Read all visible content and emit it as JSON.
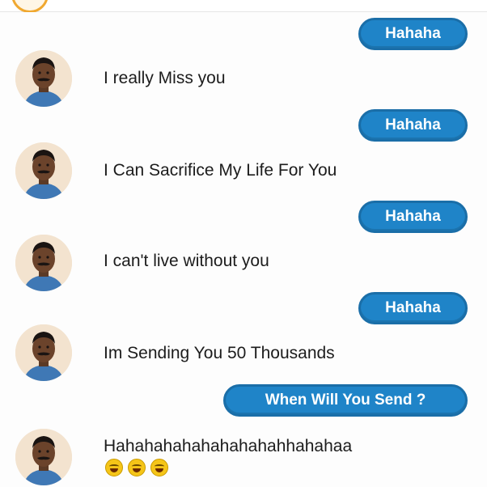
{
  "conversation": {
    "outgoing": [
      {
        "text": "Hahaha"
      },
      {
        "text": "Hahaha"
      },
      {
        "text": "Hahaha"
      },
      {
        "text": "Hahaha"
      },
      {
        "text": "When Will You Send ?"
      }
    ],
    "incoming": [
      {
        "text": "I really Miss you"
      },
      {
        "text": "I Can Sacrifice My Life For You"
      },
      {
        "text": "I can't live without you"
      },
      {
        "text": "Im Sending You 50 Thousands"
      },
      {
        "text": "Hahahahahahahahahahhahahaa"
      }
    ],
    "last_message_emoji": [
      "laughing-emoji",
      "laughing-emoji",
      "laughing-emoji"
    ]
  },
  "colors": {
    "bubble_fill": "#1f84c8",
    "bubble_border": "#1a6ea8",
    "text": "#1c1c1c",
    "avatar_bg": "#f3e3cf"
  }
}
